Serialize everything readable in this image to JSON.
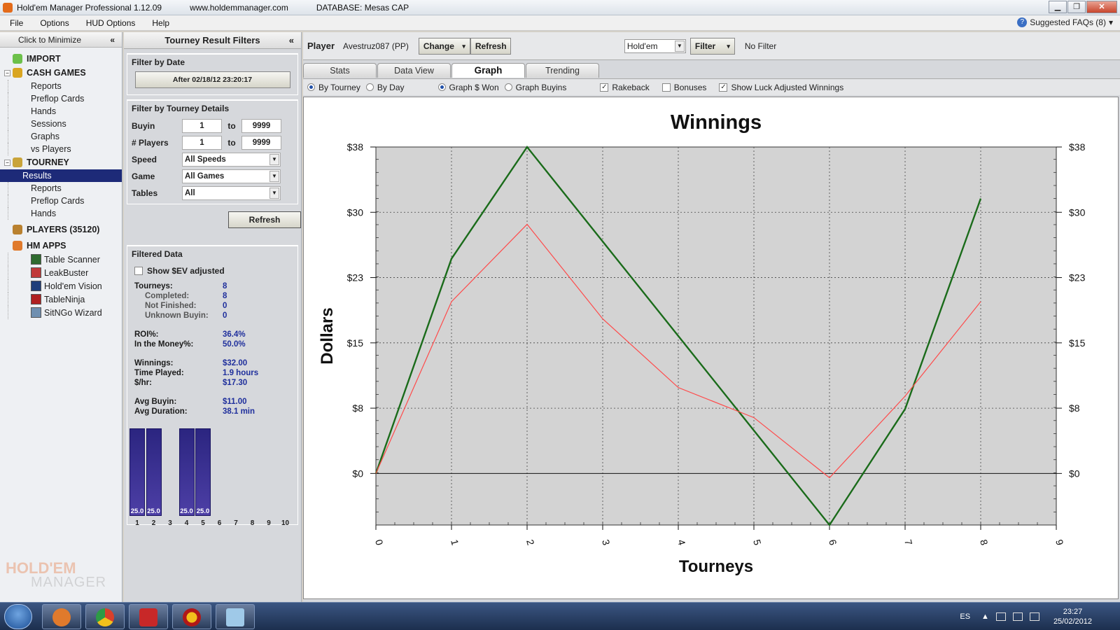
{
  "window": {
    "title": "Hold'em Manager Professional 1.12.09",
    "site": "www.holdemmanager.com",
    "database": "DATABASE: Mesas CAP",
    "buttons": [
      "▁",
      "❐",
      "✕"
    ]
  },
  "menu": {
    "items": [
      "File",
      "Options",
      "HUD Options",
      "Help"
    ],
    "faq": "Suggested FAQs (8)",
    "faq_arrow": "▾"
  },
  "nav": {
    "minimize": "Click to Minimize",
    "chevron": "«",
    "import": "IMPORT",
    "cash_games": "CASH GAMES",
    "cash_items": [
      "Reports",
      "Preflop Cards",
      "Hands",
      "Sessions",
      "Graphs",
      "vs Players"
    ],
    "tourney": "TOURNEY",
    "tourney_items": [
      "Results",
      "Reports",
      "Preflop Cards",
      "Hands"
    ],
    "players": "PLAYERS (35120)",
    "hm_apps": "HM APPS",
    "apps": [
      "Table Scanner",
      "LeakBuster",
      "Hold'em Vision",
      "TableNinja",
      "SitNGo Wizard"
    ],
    "logo_top": "HOLD'EM",
    "logo_bottom": "MANAGER",
    "colors": {
      "selected": "#1d2a78"
    }
  },
  "filters": {
    "title": "Tourney Result Filters",
    "chevron": "«",
    "by_date": "Filter by Date",
    "date_button": "After 02/18/12 23:20:17",
    "by_details": "Filter by Tourney Details",
    "buyin_label": "Buyin",
    "buyin_from": "1",
    "buyin_to": "9999",
    "players_label": "# Players",
    "players_from": "1",
    "players_to": "9999",
    "to": "to",
    "speed_label": "Speed",
    "speed_value": "All Speeds",
    "game_label": "Game",
    "game_value": "All Games",
    "tables_label": "Tables",
    "tables_value": "All",
    "refresh": "Refresh",
    "filtered_data": "Filtered Data",
    "show_ev": "Show $EV adjusted",
    "stats": [
      {
        "k": "Tourneys:",
        "v": "8"
      },
      {
        "k": "Completed:",
        "v": "8",
        "sub": true
      },
      {
        "k": "Not Finished:",
        "v": "0",
        "sub": true
      },
      {
        "k": "Unknown Buyin:",
        "v": "0",
        "sub": true
      },
      {
        "gap": true
      },
      {
        "k": "ROI%:",
        "v": "36.4%"
      },
      {
        "k": "In the Money%:",
        "v": "50.0%"
      },
      {
        "gap": true
      },
      {
        "k": "Winnings:",
        "v": "$32.00"
      },
      {
        "k": "Time Played:",
        "v": "1.9 hours"
      },
      {
        "k": "$/hr:",
        "v": "$17.30"
      },
      {
        "gap": true
      },
      {
        "k": "Avg Buyin:",
        "v": "$11.00"
      },
      {
        "k": "Avg Duration:",
        "v": "38.1 min"
      }
    ],
    "histogram": {
      "categories": [
        "1",
        "2",
        "3",
        "4",
        "5",
        "6",
        "7",
        "8",
        "9",
        "10"
      ],
      "values": [
        25.0,
        25.0,
        0,
        25.0,
        25.0,
        0,
        0,
        0,
        0,
        0
      ],
      "labels": [
        "25.0",
        "25.0",
        "",
        "25.0",
        "25.0",
        "",
        "",
        "",
        "",
        ""
      ],
      "max": 25.0
    }
  },
  "main": {
    "player_label": "Player",
    "player_name": "Avestruz087 (PP)",
    "change": "Change",
    "change_arrow": "▾",
    "refresh": "Refresh",
    "game": "Hold'em",
    "filter": "Filter",
    "filter_arrow": "▾",
    "no_filter": "No Filter",
    "tabs": [
      "Stats",
      "Data View",
      "Graph",
      "Trending"
    ],
    "active_tab": 2,
    "options": {
      "by_tourney": "By Tourney",
      "by_day": "By Day",
      "graph_won": "Graph $ Won",
      "graph_buyins": "Graph Buyins",
      "rakeback": "Rakeback",
      "bonuses": "Bonuses",
      "luck_adjusted": "Show Luck Adjusted Winnings"
    }
  },
  "chart_data": {
    "type": "line",
    "title": "Winnings",
    "xlabel": "Tourneys",
    "ylabel": "Dollars",
    "xlim": [
      0,
      9
    ],
    "ylim": [
      -6,
      38
    ],
    "x_ticks": [
      0,
      1,
      2,
      3,
      4,
      5,
      6,
      7,
      8,
      9
    ],
    "y_ticks": [
      0,
      7.6,
      15.2,
      22.8,
      30.4,
      38
    ],
    "y_tick_labels": [
      "$0",
      "$8",
      "$15",
      "$23",
      "$30",
      "$38"
    ],
    "grid": true,
    "series": [
      {
        "color": "#1a6b1a",
        "x": [
          0,
          1,
          2,
          3,
          4,
          5,
          6,
          7,
          8
        ],
        "y": [
          0,
          25,
          38,
          27,
          16,
          5,
          -6,
          7.5,
          32
        ]
      },
      {
        "color": "#ff4a4a",
        "x": [
          0,
          1,
          2,
          3,
          4,
          5,
          6,
          7,
          8
        ],
        "y": [
          0,
          20,
          29,
          18,
          10,
          6.5,
          -0.5,
          9,
          20
        ]
      }
    ]
  },
  "taskbar": {
    "lang": "ES",
    "time": "23:27",
    "date": "25/02/2012"
  }
}
